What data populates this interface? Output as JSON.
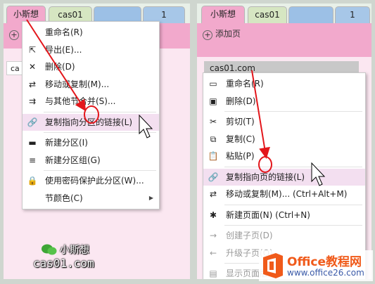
{
  "left": {
    "tabs": [
      {
        "label": "小斯想",
        "color": "#f2a9cc"
      },
      {
        "label": "cas01",
        "color": "#d6e6c2"
      },
      {
        "label": "",
        "color": "#9cc0e6"
      },
      {
        "label": "1",
        "color": "#a7c7e8"
      }
    ],
    "add_page": "",
    "input_value": "ca",
    "menu": [
      {
        "label": "重命名(R)",
        "icon": "rename-icon",
        "glyph": "",
        "hl": false
      },
      {
        "label": "导出(E)...",
        "icon": "export-icon",
        "glyph": "⇱",
        "hl": false
      },
      {
        "label": "删除(D)",
        "icon": "delete-icon",
        "glyph": "✕",
        "hl": false
      },
      {
        "label": "移动或复制(M)...",
        "icon": "move-copy-icon",
        "glyph": "⇄",
        "hl": false
      },
      {
        "label": "与其他节合并(S)...",
        "icon": "merge-icon",
        "glyph": "⇉",
        "hl": false
      },
      {
        "label": "复制指向分区的链接(L)",
        "icon": "link-icon",
        "glyph": "🔗",
        "hl": true
      },
      {
        "label": "新建分区(I)",
        "icon": "new-section-icon",
        "glyph": "▬",
        "hl": false
      },
      {
        "label": "新建分区组(G)",
        "icon": "new-section-group-icon",
        "glyph": "≡",
        "hl": false
      },
      {
        "label": "使用密码保护此分区(W)...",
        "icon": "lock-icon",
        "glyph": "🔒",
        "hl": false
      },
      {
        "label": "节颜色(C)",
        "icon": "section-color-icon",
        "glyph": "",
        "hl": false,
        "submenu": true
      }
    ],
    "watermark_name": "小斯想",
    "watermark_domain": "cas01.com"
  },
  "right": {
    "tabs": [
      {
        "label": "小斯想",
        "color": "#f2a9cc"
      },
      {
        "label": "cas01",
        "color": "#d6e6c2"
      },
      {
        "label": "",
        "color": "#9cc0e6"
      },
      {
        "label": "1",
        "color": "#a7c7e8"
      }
    ],
    "add_page": "添加页",
    "page_item": "cas01.com",
    "menu": [
      {
        "label": "重命名(R)",
        "icon": "rename-icon",
        "glyph": "▭",
        "dis": false
      },
      {
        "label": "删除(D)",
        "icon": "delete-icon",
        "glyph": "▣",
        "dis": false
      },
      {
        "label": "剪切(T)",
        "icon": "cut-icon",
        "glyph": "✂",
        "dis": false
      },
      {
        "label": "复制(C)",
        "icon": "copy-icon",
        "glyph": "⧉",
        "dis": false
      },
      {
        "label": "粘贴(P)",
        "icon": "paste-icon",
        "glyph": "📋",
        "dis": false
      },
      {
        "label": "复制指向页的链接(L)",
        "icon": "link-icon",
        "glyph": "🔗",
        "dis": false,
        "hl": true
      },
      {
        "label": "移动或复制(M)...   (Ctrl+Alt+M)",
        "icon": "move-copy-icon",
        "glyph": "⇄",
        "dis": false
      },
      {
        "label": "新建页面(N)   (Ctrl+N)",
        "icon": "new-page-icon",
        "glyph": "✱",
        "dis": false
      },
      {
        "label": "创建子页(D)",
        "icon": "arrow-right-icon",
        "glyph": "→",
        "dis": true
      },
      {
        "label": "升级子页(O)",
        "icon": "arrow-left-icon",
        "glyph": "←",
        "dis": true
      },
      {
        "label": "显示页面版本",
        "icon": "page-version-icon",
        "glyph": "▤",
        "dis": true
      }
    ]
  },
  "brand": {
    "name": "Office教程网",
    "url": "www.office26.com",
    "orange": "#f05a1a"
  }
}
